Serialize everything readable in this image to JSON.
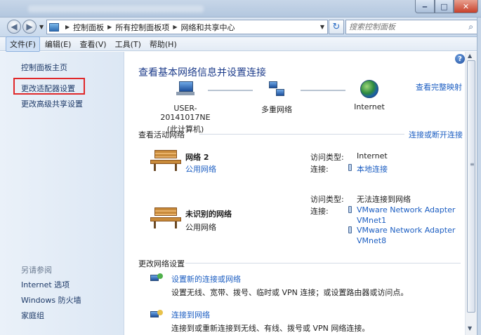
{
  "window": {
    "controls": {
      "min": "‒",
      "max": "□",
      "close": "✕"
    }
  },
  "address": {
    "crumbs": [
      "控制面板",
      "所有控制面板项",
      "网络和共享中心"
    ],
    "search_placeholder": "搜索控制面板"
  },
  "menu": [
    "文件(F)",
    "编辑(E)",
    "查看(V)",
    "工具(T)",
    "帮助(H)"
  ],
  "sidebar": {
    "links": [
      "控制面板主页",
      "更改适配器设置",
      "更改高级共享设置"
    ],
    "see_also_heading": "另请参阅",
    "see_also": [
      "Internet 选项",
      "Windows 防火墙",
      "家庭组"
    ]
  },
  "main": {
    "title": "查看基本网络信息并设置连接",
    "full_map_link": "查看完整映射",
    "map_nodes": [
      {
        "line1": "USER-20141017NE",
        "line2": "(此计算机)"
      },
      {
        "line1": "多重网络"
      },
      {
        "line1": "Internet"
      }
    ],
    "active_heading": "查看活动网络",
    "connect_link": "连接或断开连接",
    "networks": [
      {
        "name": "网络  2",
        "type": "公用网络",
        "access_label": "访问类型:",
        "access_value": "Internet",
        "conn_label": "连接:",
        "connections": [
          "本地连接"
        ]
      },
      {
        "name": "未识别的网络",
        "type": "公用网络",
        "access_label": "访问类型:",
        "access_value": "无法连接到网络",
        "conn_label": "连接:",
        "connections": [
          "VMware Network Adapter",
          "VMnet1",
          "VMware Network Adapter",
          "VMnet8"
        ]
      }
    ],
    "change_heading": "更改网络设置",
    "tasks": [
      {
        "link": "设置新的连接或网络",
        "desc": "设置无线、宽带、拨号、临时或 VPN 连接；或设置路由器或访问点。"
      },
      {
        "link": "连接到网络",
        "desc": "连接到或重新连接到无线、有线、拨号或 VPN 网络连接。"
      }
    ]
  },
  "icons": {
    "help": "?",
    "refresh": "↻",
    "search": "⌕"
  }
}
